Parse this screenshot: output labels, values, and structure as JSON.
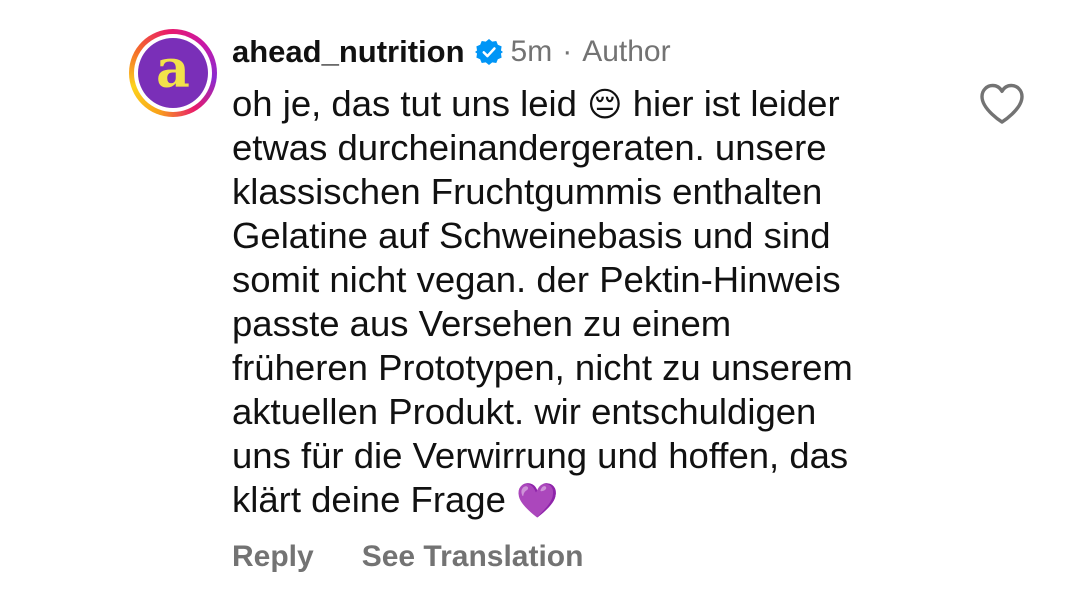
{
  "comment": {
    "avatar_letter": "a",
    "username": "ahead_nutrition",
    "verified_icon": "verified-badge-icon",
    "timestamp": "5m",
    "separator": "·",
    "role": "Author",
    "body_lines": [
      {
        "text": "oh je, das tut uns leid ",
        "emoji": "😔",
        "after": " hier ist leider"
      },
      {
        "text": "etwas durcheinandergeraten. unsere"
      },
      {
        "text": "klassischen Fruchtgummis enthalten"
      },
      {
        "text": "Gelatine auf Schweinebasis und sind"
      },
      {
        "text": "somit nicht vegan. der Pektin-Hinweis"
      },
      {
        "text": "passte aus Versehen zu einem"
      },
      {
        "text": "früheren Prototypen, nicht zu unserem"
      },
      {
        "text": "aktuellen Produkt. wir entschuldigen"
      },
      {
        "text": "uns für die Verwirrung und hoffen, das"
      },
      {
        "text": "klärt deine Frage ",
        "emoji": "💜"
      }
    ],
    "like_icon": "heart-outline-icon",
    "actions": {
      "reply_label": "Reply",
      "translate_label": "See Translation"
    }
  },
  "colors": {
    "text_primary": "#111111",
    "text_secondary": "#737373",
    "verified_blue": "#0095f6",
    "avatar_bg": "#7a2fb8",
    "avatar_letter": "#f2e24a"
  }
}
